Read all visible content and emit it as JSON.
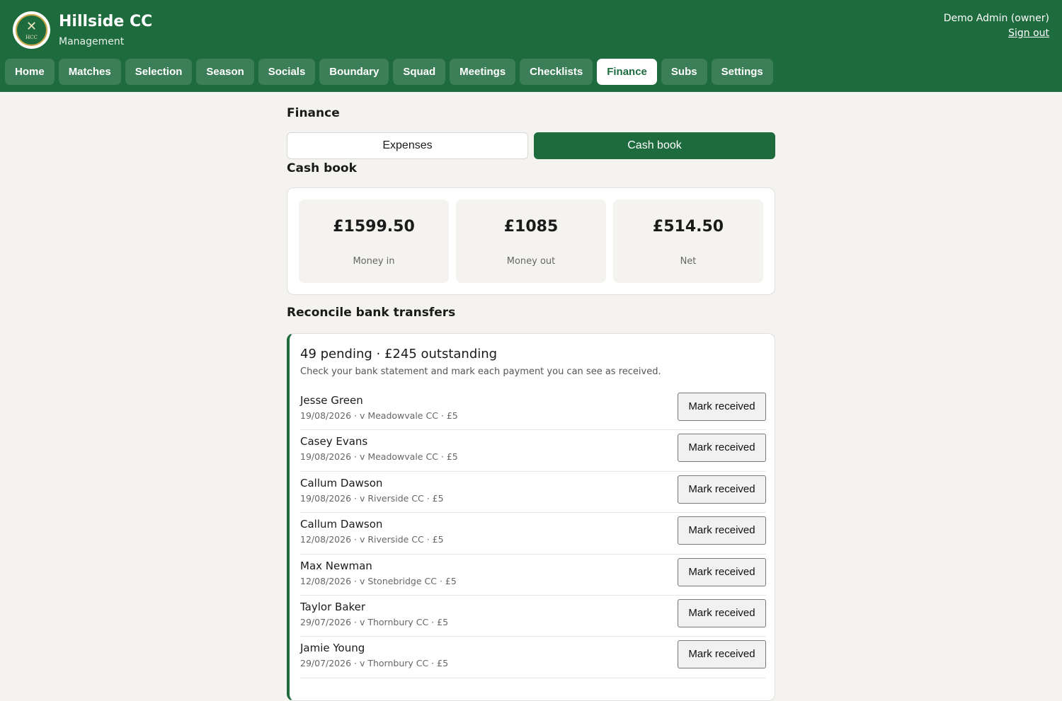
{
  "header": {
    "logo_text": "HCC",
    "club_name": "Hillside CC",
    "subtitle": "Management",
    "user": "Demo Admin (owner)",
    "sign_out": "Sign out"
  },
  "nav": [
    {
      "label": "Home",
      "active": false
    },
    {
      "label": "Matches",
      "active": false
    },
    {
      "label": "Selection",
      "active": false
    },
    {
      "label": "Season",
      "active": false
    },
    {
      "label": "Socials",
      "active": false
    },
    {
      "label": "Boundary",
      "active": false
    },
    {
      "label": "Squad",
      "active": false
    },
    {
      "label": "Meetings",
      "active": false
    },
    {
      "label": "Checklists",
      "active": false
    },
    {
      "label": "Finance",
      "active": true
    },
    {
      "label": "Subs",
      "active": false
    },
    {
      "label": "Settings",
      "active": false
    }
  ],
  "page": {
    "title": "Finance",
    "tabs": {
      "expenses": "Expenses",
      "cash_book": "Cash book",
      "selected": "Cash book"
    },
    "section_title": "Cash book"
  },
  "stats": [
    {
      "value": "£1599.50",
      "label": "Money in"
    },
    {
      "value": "£1085",
      "label": "Money out"
    },
    {
      "value": "£514.50",
      "label": "Net"
    }
  ],
  "reconcile": {
    "heading": "Reconcile bank transfers",
    "summary": "49 pending · £245 outstanding",
    "hint": "Check your bank statement and mark each payment you can see as received.",
    "button_label": "Mark received",
    "items": [
      {
        "name": "Jesse Green",
        "meta": "19/08/2026 · v Meadowvale CC · £5"
      },
      {
        "name": "Casey Evans",
        "meta": "19/08/2026 · v Meadowvale CC · £5"
      },
      {
        "name": "Callum Dawson",
        "meta": "19/08/2026 · v Riverside CC · £5"
      },
      {
        "name": "Callum Dawson",
        "meta": "12/08/2026 · v Riverside CC · £5"
      },
      {
        "name": "Max Newman",
        "meta": "12/08/2026 · v Stonebridge CC · £5"
      },
      {
        "name": "Taylor Baker",
        "meta": "29/07/2026 · v Thornbury CC · £5"
      },
      {
        "name": "Jamie Young",
        "meta": "29/07/2026 · v Thornbury CC · £5"
      }
    ]
  },
  "colors": {
    "brand": "#1e6b3e",
    "nav_item": "#3b7e57",
    "background": "#f4f3ef"
  }
}
